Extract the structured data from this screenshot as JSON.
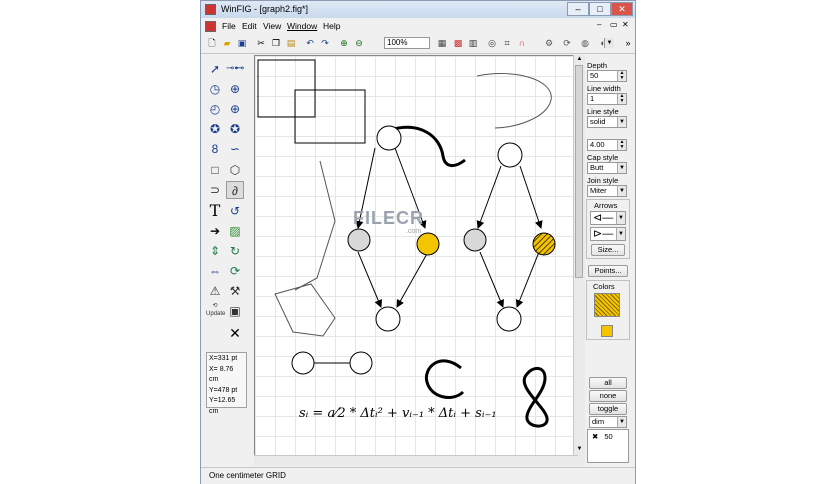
{
  "window": {
    "title": "WinFIG - [graph2.fig*]",
    "min": "–",
    "max": "□",
    "close": "✕",
    "restore": "▭",
    "sub_close": "✕"
  },
  "menu": [
    "File",
    "Edit",
    "View",
    "Window",
    "Help"
  ],
  "toolbar": {
    "zoom": "100%"
  },
  "coords": {
    "x_pt": "X=331 pt",
    "x_cm": "X= 8.76 cm",
    "y_pt": "Y=478 pt",
    "y_cm": "Y=12.65 cm"
  },
  "right": {
    "depth_label": "Depth",
    "depth": "50",
    "linewidth_label": "Line width",
    "linewidth": "1",
    "linestyle_label": "Line style",
    "linestyle": "solid",
    "dashlen": "4.00",
    "capstyle_label": "Cap style",
    "capstyle": "Butt",
    "joinstyle_label": "Join style",
    "joinstyle": "Miter",
    "arrows_label": "Arrows",
    "size_btn": "Size...",
    "points_btn": "Points...",
    "colors_label": "Colors",
    "all_btn": "all",
    "none_btn": "none",
    "toggle_btn": "toggle",
    "dim": "dim",
    "depth_item": "50",
    "depth_check": "✖"
  },
  "watermark": {
    "text": "FILECR",
    "sub": ".com"
  },
  "formula": "sᵢ = a⁄2 * Δtᵢ² + vᵢ₋₁ * Δtᵢ + sᵢ₋₁",
  "status": "One centimeter GRID",
  "colors": {
    "yellow": "#f5c400",
    "gray": "#d8d8d8"
  }
}
